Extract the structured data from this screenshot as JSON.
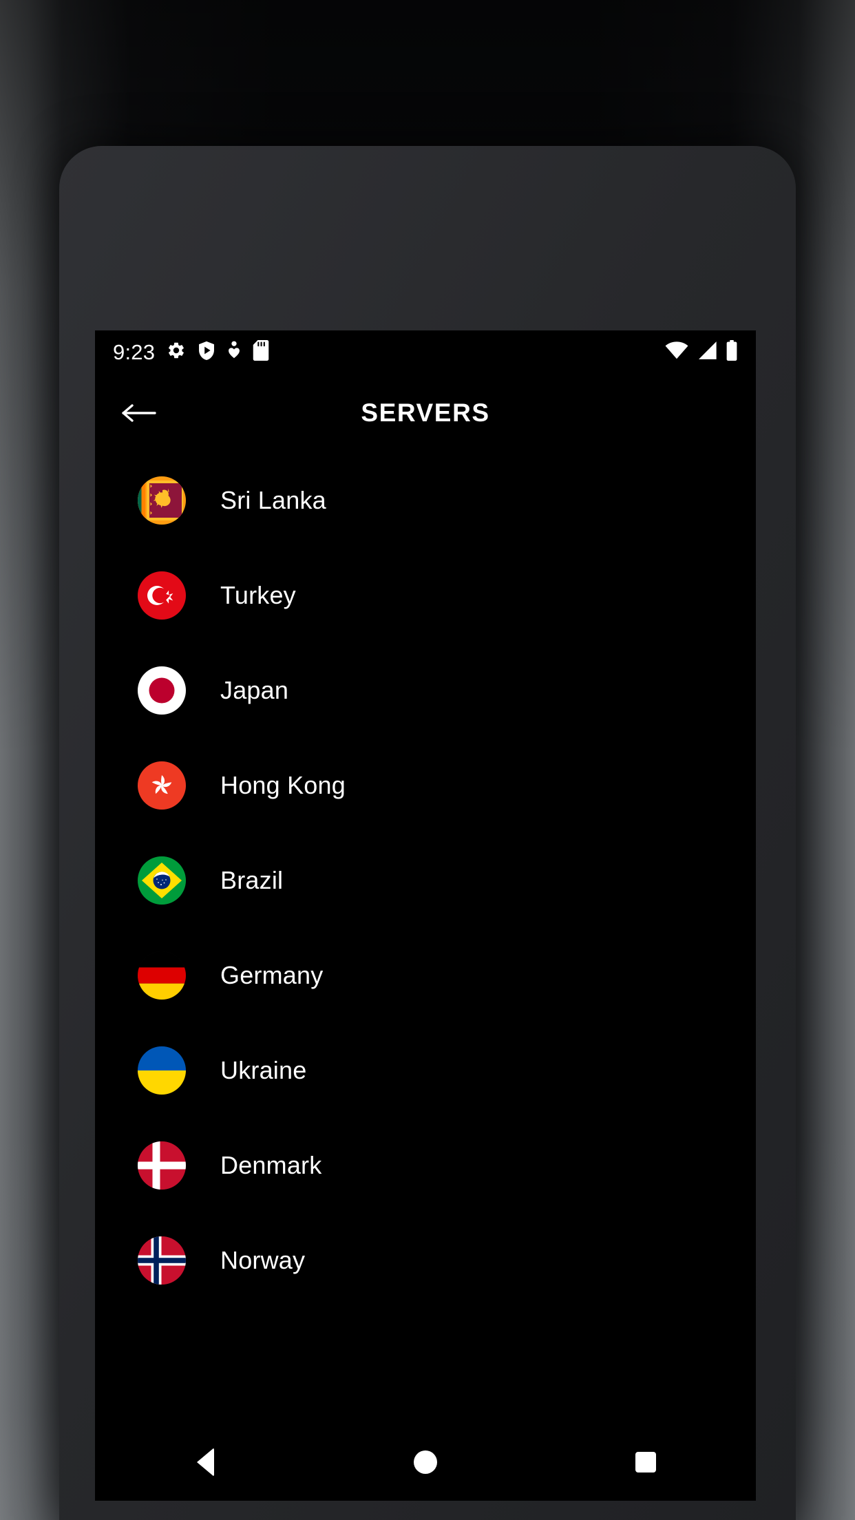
{
  "status_bar": {
    "time": "9:23",
    "left_icons": [
      "gear-icon",
      "play-protect-shield-icon",
      "heart-location-icon",
      "sd-card-icon"
    ],
    "right_icons": [
      "wifi-icon",
      "cellular-signal-icon",
      "battery-icon"
    ]
  },
  "app_bar": {
    "title": "SERVERS",
    "back_icon": "arrow-left-icon"
  },
  "colors": {
    "screen_background": "#000000",
    "text_primary": "#ffffff",
    "phone_body": "#2a2c2f"
  },
  "servers": [
    {
      "name": "Sri Lanka",
      "flag": "flag-sri-lanka-icon"
    },
    {
      "name": "Turkey",
      "flag": "flag-turkey-icon"
    },
    {
      "name": "Japan",
      "flag": "flag-japan-icon"
    },
    {
      "name": "Hong Kong",
      "flag": "flag-hong-kong-icon"
    },
    {
      "name": "Brazil",
      "flag": "flag-brazil-icon"
    },
    {
      "name": "Germany",
      "flag": "flag-germany-icon"
    },
    {
      "name": "Ukraine",
      "flag": "flag-ukraine-icon"
    },
    {
      "name": "Denmark",
      "flag": "flag-denmark-icon"
    },
    {
      "name": "Norway",
      "flag": "flag-norway-icon"
    }
  ],
  "nav_bar": {
    "back_label": "Back",
    "home_label": "Home",
    "recents_label": "Recents"
  }
}
